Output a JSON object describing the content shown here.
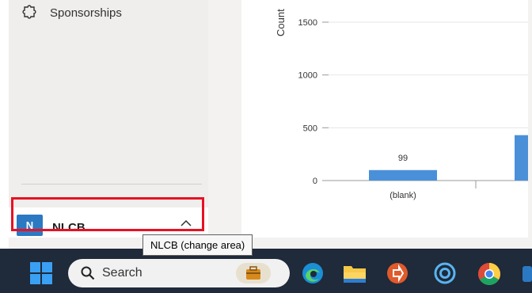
{
  "sidebar": {
    "items": [
      {
        "label": "Sponsorships",
        "icon": "puzzle-icon"
      }
    ]
  },
  "area_switcher": {
    "avatar_letter": "N",
    "name": "NLCB",
    "tooltip": "NLCB (change area)",
    "avatar_color": "#2b79c2"
  },
  "chart_data": {
    "type": "bar",
    "categories": [
      "(blank)",
      ""
    ],
    "values": [
      99,
      430
    ],
    "data_labels": [
      "99",
      ""
    ],
    "yticks": [
      "0",
      "500",
      "1000",
      "1500"
    ],
    "ylabel": "Count",
    "ylim": [
      0,
      1600
    ],
    "grid": true,
    "bar_color": "#4a90d9"
  },
  "taskbar": {
    "search_placeholder": "Search",
    "icons": [
      "windows-start-icon",
      "search-icon",
      "briefcase-icon",
      "edge-icon",
      "file-explorer-icon",
      "remote-desktop-icon",
      "cortana-icon",
      "chrome-icon"
    ]
  }
}
